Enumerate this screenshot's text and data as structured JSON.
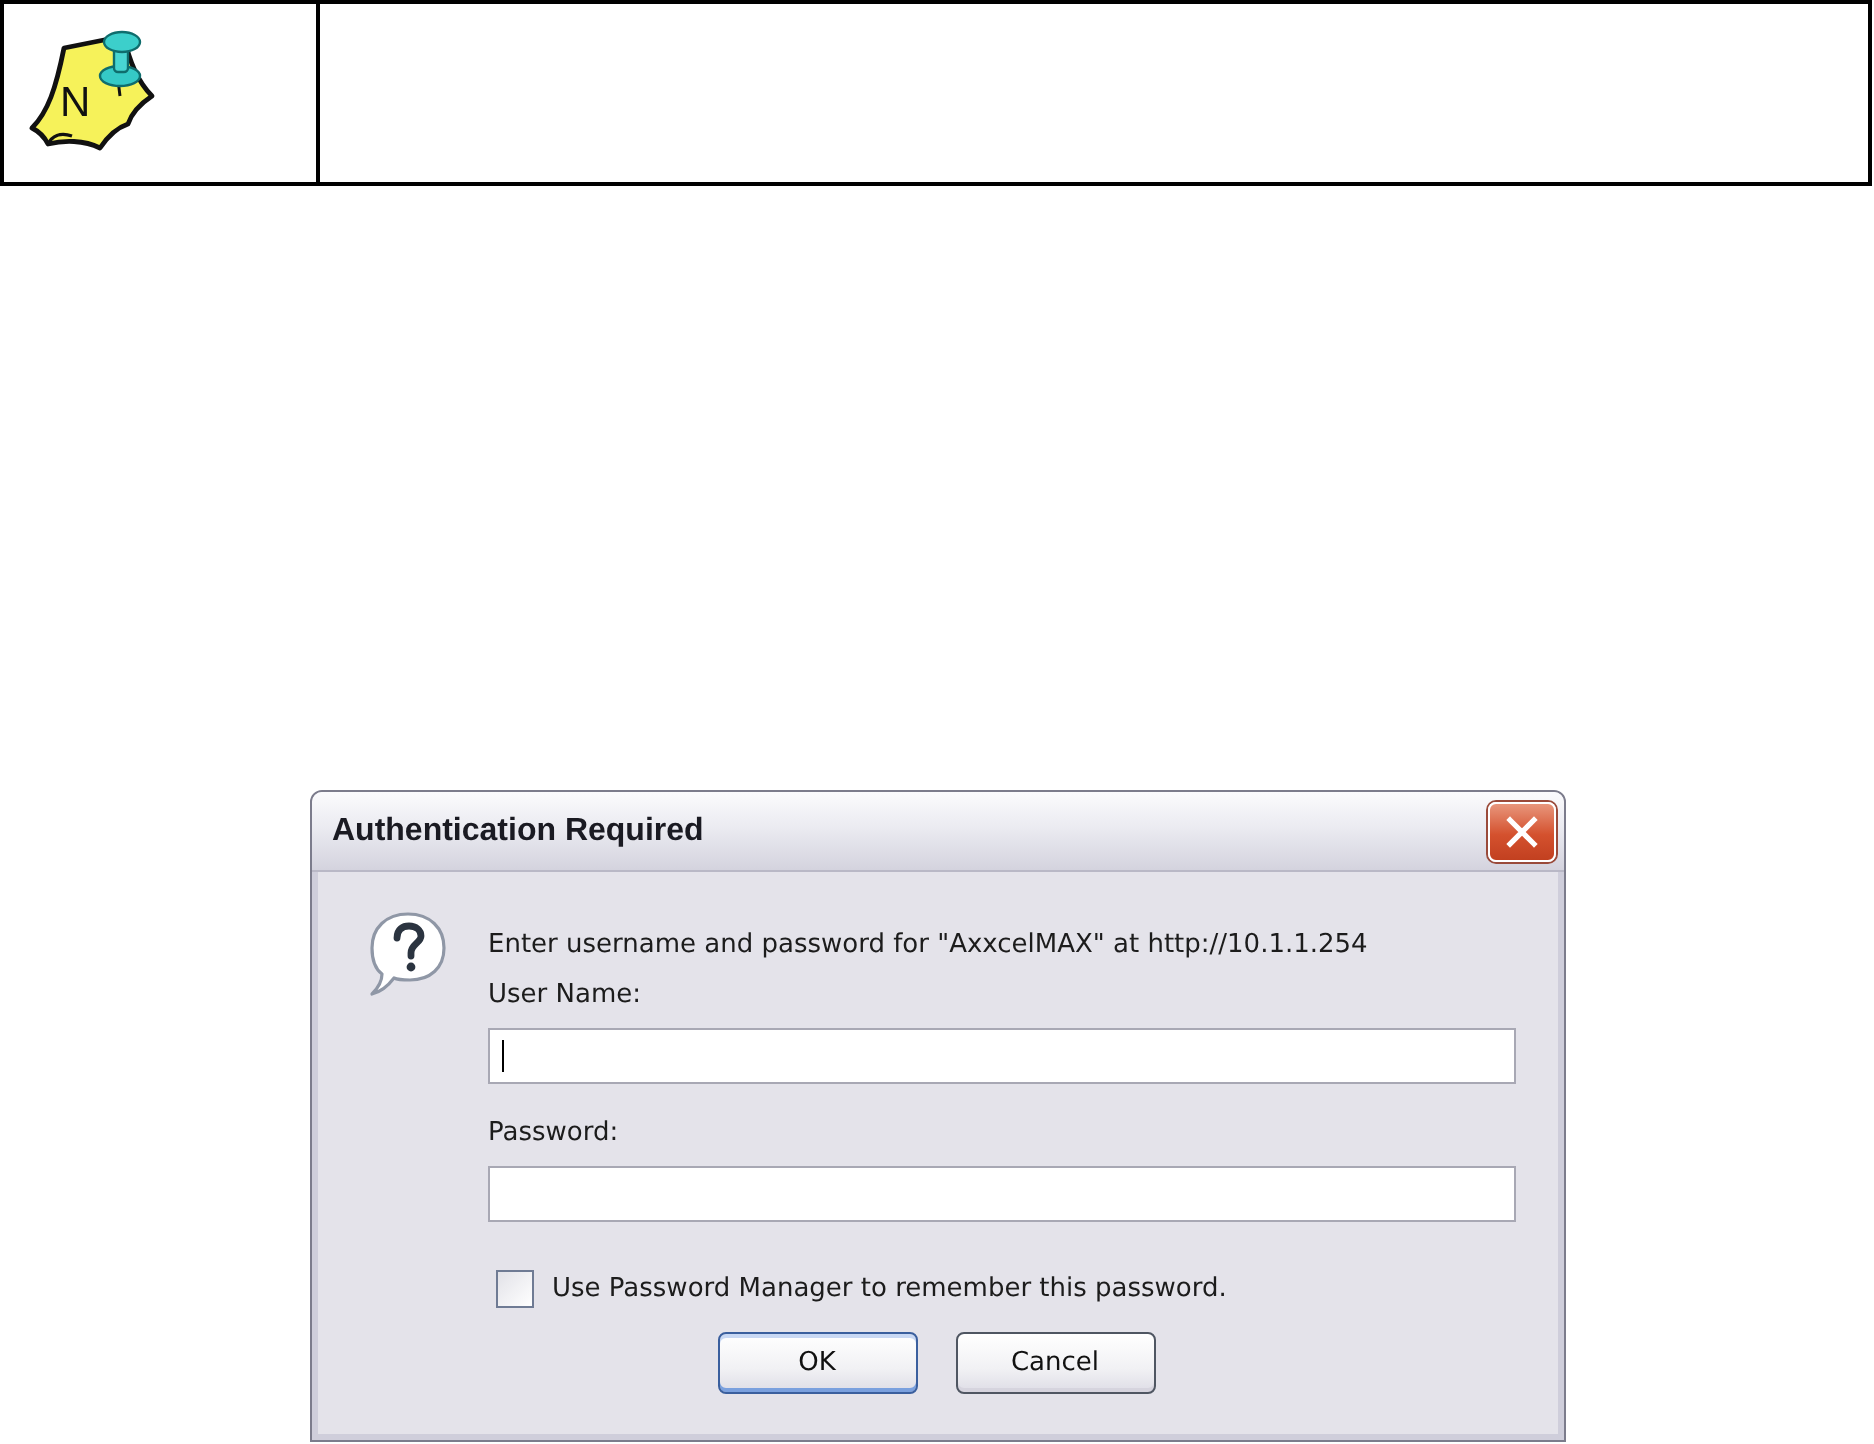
{
  "note": {
    "icon_letter": "N"
  },
  "dialog": {
    "title": "Authentication Required",
    "message": "Enter username and password for \"AxxcelMAX\" at http://10.1.1.254",
    "fields": [
      {
        "label": "User Name:",
        "focused": true
      },
      {
        "label": "Password:",
        "focused": false
      }
    ],
    "remember": {
      "label": "Use Password Manager to remember this password.",
      "checked": false
    },
    "buttons": [
      {
        "label": "OK",
        "default": true
      },
      {
        "label": "Cancel",
        "default": false
      }
    ]
  }
}
